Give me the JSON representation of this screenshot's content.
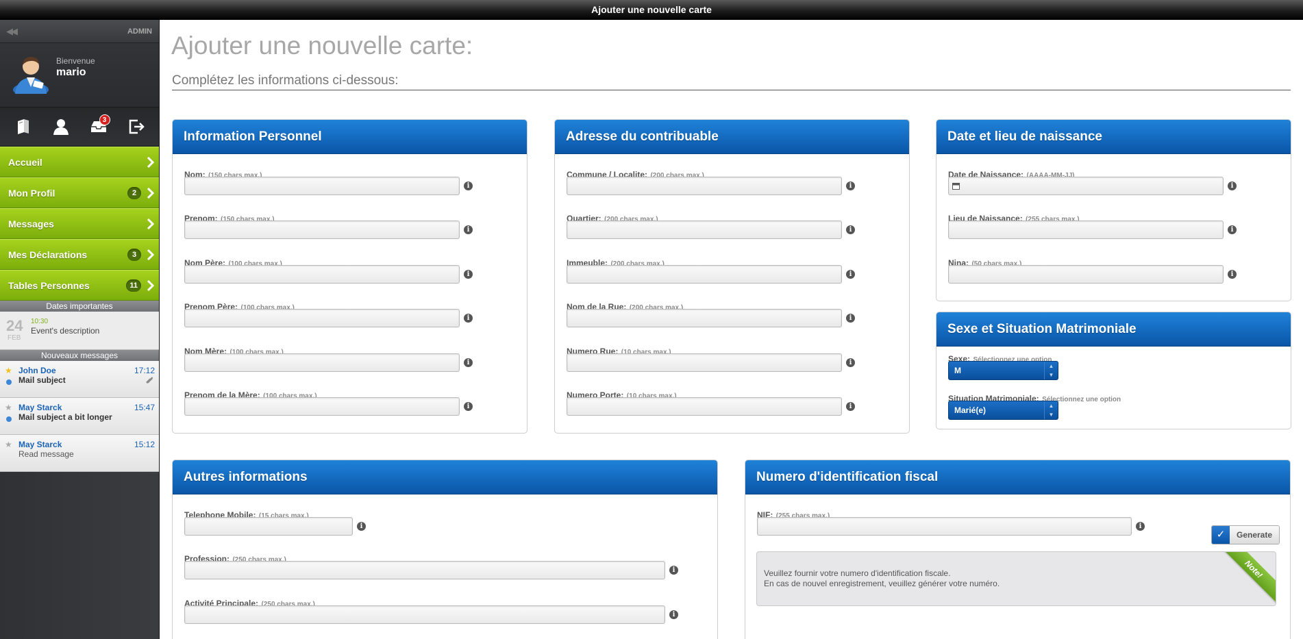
{
  "window": {
    "title": "Ajouter une nouvelle carte"
  },
  "sidebar": {
    "admin_label": "ADMIN",
    "welcome": "Bienvenue",
    "username": "mario",
    "notif_count": "3",
    "nav": [
      {
        "label": "Accueil",
        "count": ""
      },
      {
        "label": "Mon Profil",
        "count": "2"
      },
      {
        "label": "Messages",
        "count": ""
      },
      {
        "label": "Mes Déclarations",
        "count": "3"
      },
      {
        "label": "Tables Personnes",
        "count": "11"
      }
    ],
    "dates_header": "Dates importantes",
    "event": {
      "day": "24",
      "month": "FEB",
      "time": "10:30",
      "description": "Event's description"
    },
    "messages_header": "Nouveaux messages",
    "messages": [
      {
        "from": "John Doe",
        "subject": "Mail subject",
        "time": "17:12"
      },
      {
        "from": "May Starck",
        "subject": "Mail subject a bit longer",
        "time": "15:47"
      },
      {
        "from": "May Starck",
        "subject": "Read message",
        "time": "15:12"
      }
    ]
  },
  "page": {
    "title": "Ajouter une nouvelle carte:",
    "subtitle": "Complétez les informations ci-dessous:"
  },
  "personal": {
    "title": "Information Personnel",
    "fields": [
      {
        "label": "Nom:",
        "hint": "(150 chars max.)"
      },
      {
        "label": "Prenom:",
        "hint": "(150 chars max.)"
      },
      {
        "label": "Nom Père:",
        "hint": "(100 chars max.)"
      },
      {
        "label": "Prenom Père:",
        "hint": "(100 chars max.)"
      },
      {
        "label": "Nom Mère:",
        "hint": "(100 chars max.)"
      },
      {
        "label": "Prenom de la Mère:",
        "hint": "(100 chars max.)"
      }
    ]
  },
  "address": {
    "title": "Adresse du contribuable",
    "fields": [
      {
        "label": "Commune / Localite:",
        "hint": "(200 chars max.)"
      },
      {
        "label": "Quartier:",
        "hint": "(200 chars max.)"
      },
      {
        "label": "Immeuble:",
        "hint": "(200 chars max.)"
      },
      {
        "label": "Nom de la Rue:",
        "hint": "(200 chars max.)"
      },
      {
        "label": "Numero Rue:",
        "hint": "(10 chars max.)"
      },
      {
        "label": "Numero Porte:",
        "hint": "(10 chars max.)"
      }
    ]
  },
  "birth": {
    "title": "Date et lieu de naissance",
    "fields": [
      {
        "label": "Date de Naissance:",
        "hint": "(AAAA-MM-JJ)"
      },
      {
        "label": "Lieu de Naissance:",
        "hint": "(255 chars max.)"
      },
      {
        "label": "Nina:",
        "hint": "(50 chars max.)"
      }
    ]
  },
  "sex": {
    "title": "Sexe et Situation Matrimoniale",
    "sexe_label": "Sexe:",
    "sexe_hint": "Sélectionnez une option",
    "sexe_value": "M",
    "situation_label": "Situation Matrimoniale:",
    "situation_hint": "Sélectionnez une option",
    "situation_value": "Marié(e)"
  },
  "other": {
    "title": "Autres informations",
    "fields": [
      {
        "label": "Telephone Mobile:",
        "hint": "(15 chars max.)"
      },
      {
        "label": "Profession:",
        "hint": "(250 chars max.)"
      },
      {
        "label": "Activité Principale:",
        "hint": "(250 chars max.)"
      }
    ]
  },
  "nif": {
    "title": "Numero d'identification fiscal",
    "label": "NIF:",
    "hint": "(255 chars max.)",
    "generate_label": "Generate",
    "note_line1": "Veuillez fournir votre numero d'identification fiscale.",
    "note_line2": "En cas de nouvel enregistrement, veuillez générer votre numéro.",
    "note_ribbon": "Note!"
  },
  "colors": {
    "panel_header": "#0a56a8",
    "nav_green": "#8fc015",
    "badge_red": "#d52020"
  }
}
